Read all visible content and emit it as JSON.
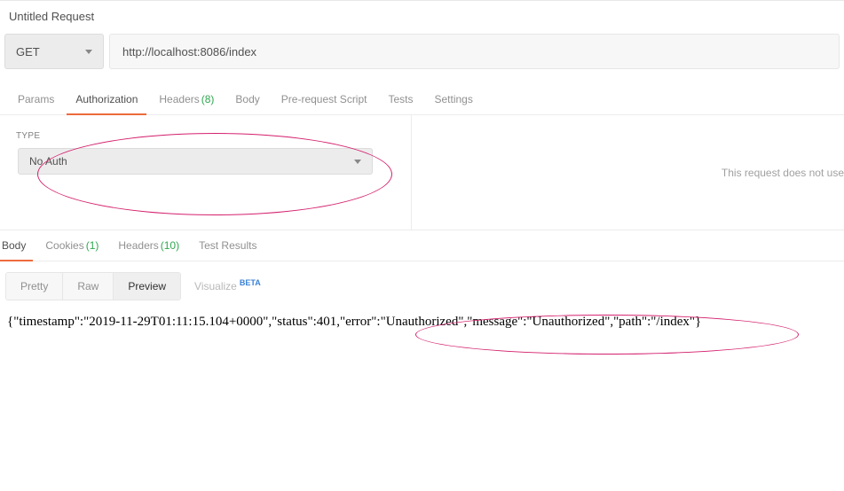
{
  "title": "Untitled Request",
  "request": {
    "method": "GET",
    "url": "http://localhost:8086/index"
  },
  "reqTabs": {
    "items": [
      {
        "label": "Params"
      },
      {
        "label": "Authorization"
      },
      {
        "label": "Headers",
        "count": "(8)"
      },
      {
        "label": "Body"
      },
      {
        "label": "Pre-request Script"
      },
      {
        "label": "Tests"
      },
      {
        "label": "Settings"
      }
    ],
    "activeIndex": 1
  },
  "auth": {
    "type_label": "TYPE",
    "selected": "No Auth",
    "right_msg": "This request does not use"
  },
  "respTabs": {
    "items": [
      {
        "label": "Body"
      },
      {
        "label": "Cookies",
        "count": "(1)"
      },
      {
        "label": "Headers",
        "count": "(10)"
      },
      {
        "label": "Test Results"
      }
    ],
    "activeIndex": 0
  },
  "views": {
    "items": [
      "Pretty",
      "Raw",
      "Preview"
    ],
    "activeIndex": 2,
    "visualize": "Visualize",
    "beta": "BETA"
  },
  "responseBody": "{\"timestamp\":\"2019-11-29T01:11:15.104+0000\",\"status\":401,\"error\":\"Unauthorized\",\"message\":\"Unauthorized\",\"path\":\"/index\"}"
}
